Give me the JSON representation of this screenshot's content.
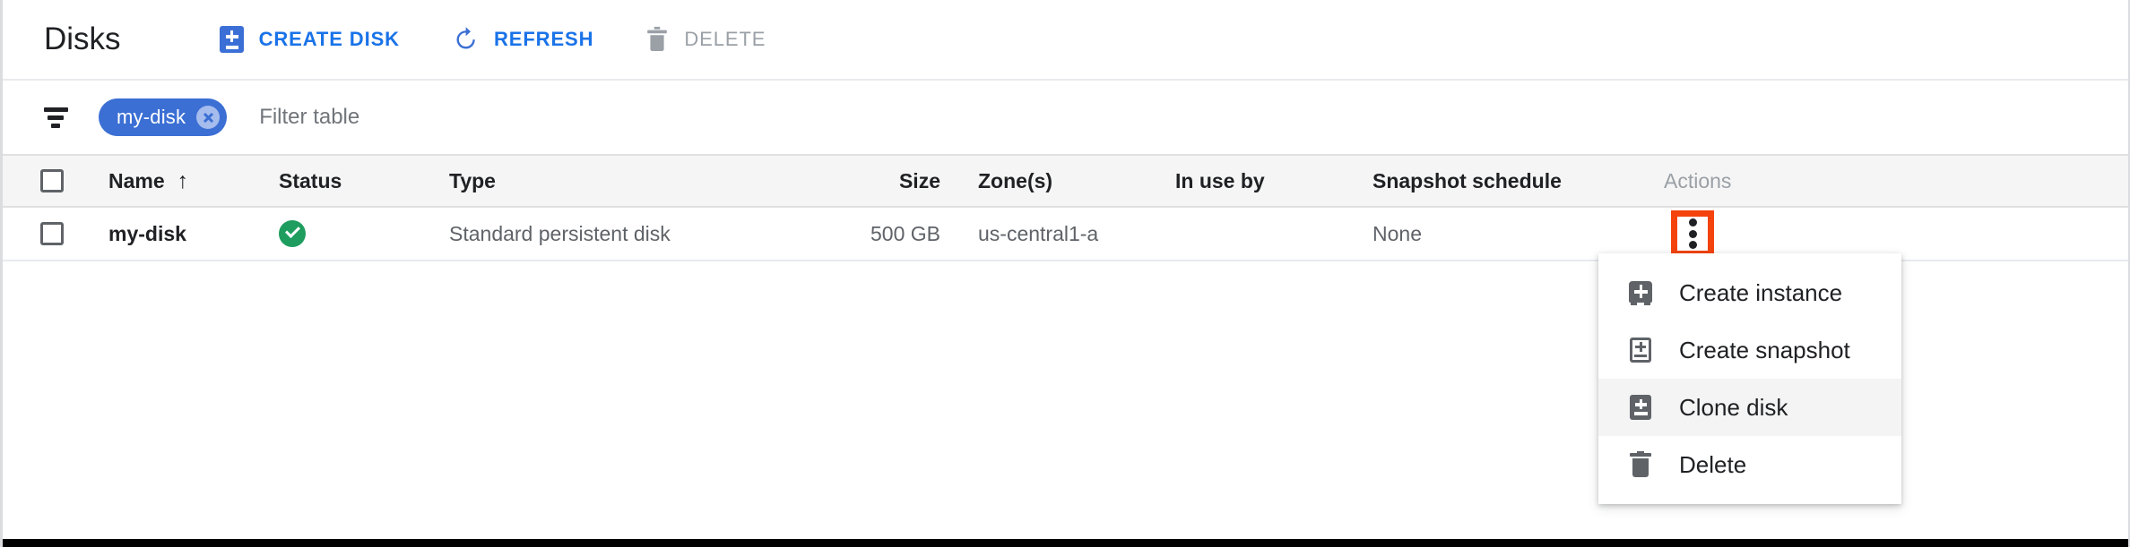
{
  "header": {
    "title": "Disks",
    "actions": [
      {
        "id": "create-disk",
        "label": "CREATE DISK",
        "icon": "create-disk-icon",
        "enabled": true
      },
      {
        "id": "refresh",
        "label": "REFRESH",
        "icon": "refresh-icon",
        "enabled": true
      },
      {
        "id": "delete",
        "label": "DELETE",
        "icon": "trash-icon",
        "enabled": false
      }
    ]
  },
  "filter": {
    "icon": "filter-icon",
    "chips": [
      {
        "label": "my-disk",
        "remove_icon": "close-icon"
      }
    ],
    "placeholder": "Filter table",
    "value": ""
  },
  "table": {
    "columns": [
      {
        "key": "select",
        "label": ""
      },
      {
        "key": "name",
        "label": "Name",
        "sort": "ascending",
        "sort_icon": "arrow-up-icon"
      },
      {
        "key": "status",
        "label": "Status"
      },
      {
        "key": "type",
        "label": "Type"
      },
      {
        "key": "size",
        "label": "Size"
      },
      {
        "key": "zone",
        "label": "Zone(s)"
      },
      {
        "key": "in_use_by",
        "label": "In use by"
      },
      {
        "key": "snapshot_schedule",
        "label": "Snapshot schedule"
      },
      {
        "key": "actions",
        "label": "Actions"
      }
    ],
    "rows": [
      {
        "selected": false,
        "name": "my-disk",
        "status": "ok",
        "status_icon": "check-circle-icon",
        "type": "Standard persistent disk",
        "size": "500 GB",
        "zone": "us-central1-a",
        "in_use_by": "",
        "snapshot_schedule": "None",
        "actions_icon": "more-vert-icon"
      }
    ]
  },
  "context_menu": {
    "open": true,
    "items": [
      {
        "label": "Create instance",
        "icon": "create-instance-icon",
        "hovered": false
      },
      {
        "label": "Create snapshot",
        "icon": "create-snapshot-icon",
        "hovered": false
      },
      {
        "label": "Clone disk",
        "icon": "clone-disk-icon",
        "hovered": true
      },
      {
        "label": "Delete",
        "icon": "trash-icon",
        "hovered": false
      }
    ]
  },
  "highlight": {
    "target": "row-actions-more-button",
    "color": "#f4430d"
  },
  "colors": {
    "accent_blue": "#1a73e8",
    "chip_blue": "#3b6fd4",
    "status_green": "#1e9d5f",
    "disabled_gray": "#9aa0a6",
    "text_primary": "#202124",
    "text_secondary": "#5f6368",
    "header_row_bg": "#f5f5f5",
    "menu_hover_bg": "#f4f4f4"
  }
}
